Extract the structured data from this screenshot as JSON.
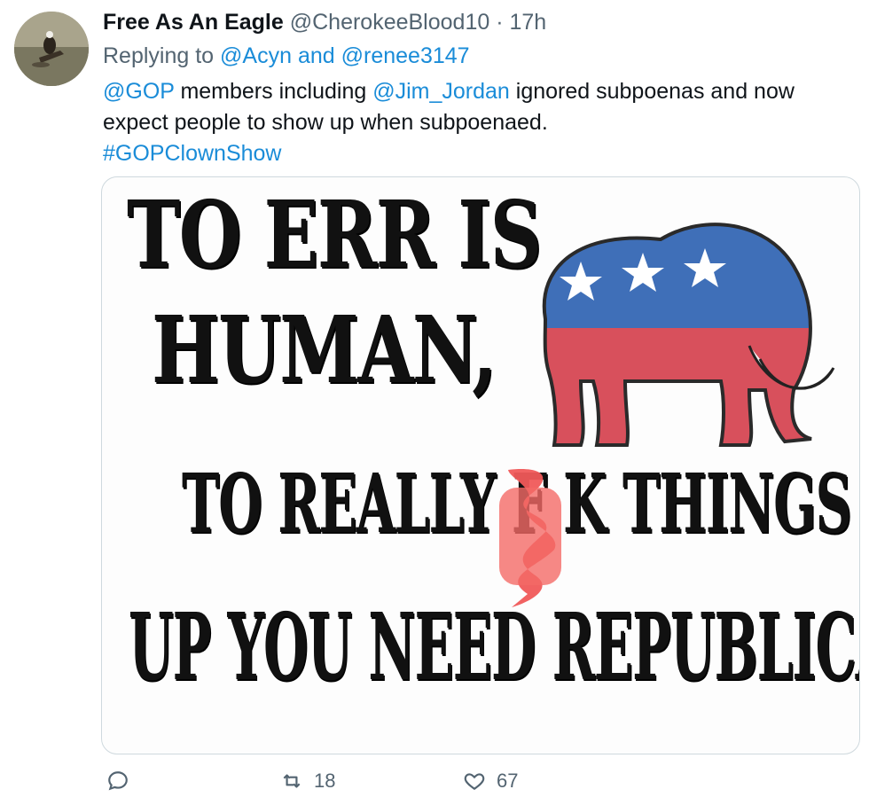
{
  "tweet": {
    "author_name": "Free As An Eagle",
    "handle": "@CherokeeBlood10",
    "separator": "·",
    "time": "17h",
    "replying_prefix": "Replying to",
    "reply_to_1": "@Acyn",
    "reply_and": "and",
    "reply_to_2": "@renee3147",
    "mention_gop": "@GOP",
    "text_part1": " members including ",
    "mention_jordan": "@Jim_Jordan",
    "text_part2": " ignored subpoenas and now expect people to show up when subpoenaed.",
    "hashtag": "#GOPClownShow"
  },
  "meme": {
    "line1": "TO ERR IS",
    "line2": "HUMAN,",
    "line3": "TO REALLY F",
    "line3_end": "K THINGS",
    "line4": "UP YOU NEED REPUBLICANS."
  },
  "actions": {
    "reply_count": "",
    "retweet_count": "18",
    "like_count": "67"
  },
  "colors": {
    "link": "#1a8cd8",
    "muted": "#536471",
    "elephant_blue": "#3f6fb8",
    "elephant_red": "#d8505c"
  },
  "icons": [
    "reply-icon",
    "retweet-icon",
    "like-icon",
    "elephant-logo"
  ]
}
